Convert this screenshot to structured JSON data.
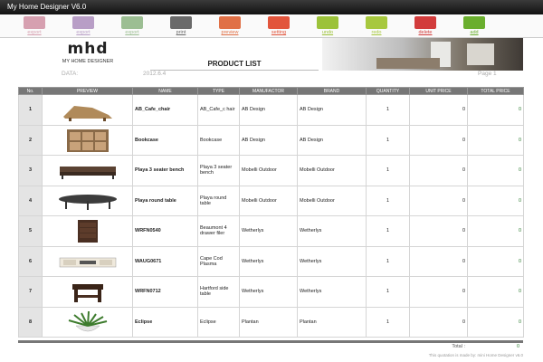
{
  "window": {
    "title": "My Home Designer V6.0"
  },
  "toolbar": [
    {
      "label": "export",
      "color": "#d6a0b0"
    },
    {
      "label": "export",
      "color": "#b89ec6"
    },
    {
      "label": "export",
      "color": "#9cbe93"
    },
    {
      "label": "print",
      "color": "#6a6a6a"
    },
    {
      "label": "preview",
      "color": "#e07046"
    },
    {
      "label": "setting",
      "color": "#e2553c"
    },
    {
      "label": "undo",
      "color": "#9cc23a"
    },
    {
      "label": "redo",
      "color": "#a7c83e"
    },
    {
      "label": "delete",
      "color": "#d23c3c"
    },
    {
      "label": "add",
      "color": "#6aae2e"
    }
  ],
  "header": {
    "logo_mark": "mhd",
    "logo_text": "MY HOME DESIGNER",
    "title": "PRODUCT LIST",
    "date_label": "DATA:",
    "date_value": "2012.6.4",
    "page_label": "Page 1"
  },
  "table": {
    "columns": [
      "No.",
      "PREVIEW",
      "NAME",
      "TYPE",
      "MANUFACTOR",
      "BRAND",
      "QUANTITY",
      "UNIT PRICE",
      "TOTAL PRICE"
    ],
    "rows": [
      {
        "no": "1",
        "preview": "lounge-chair",
        "name": "AB_Cafe_chair",
        "type": "AB_Cafe_c hair",
        "manufactor": "AB Design",
        "brand": "AB Design",
        "quantity": "1",
        "unit_price": "0",
        "total_price": "0"
      },
      {
        "no": "2",
        "preview": "bookcase",
        "name": "Bookcase",
        "type": "Bookcase",
        "manufactor": "AB Design",
        "brand": "AB Design",
        "quantity": "1",
        "unit_price": "0",
        "total_price": "0"
      },
      {
        "no": "3",
        "preview": "sofa",
        "name": "Playa 3 seater bench",
        "type": "Playa 3 seater bench",
        "manufactor": "Mobelli Outdoor",
        "brand": "Mobelli Outdoor",
        "quantity": "1",
        "unit_price": "0",
        "total_price": "0"
      },
      {
        "no": "4",
        "preview": "round-table",
        "name": "Playa round table",
        "type": "Playa round table",
        "manufactor": "Mobelli Outdoor",
        "brand": "Mobelli Outdoor",
        "quantity": "1",
        "unit_price": "0",
        "total_price": "0"
      },
      {
        "no": "5",
        "preview": "drawer",
        "name": "WRFN0540",
        "type": "Beaumont 4 drawer filer",
        "manufactor": "Wetherlys",
        "brand": "Wetherlys",
        "quantity": "1",
        "unit_price": "0",
        "total_price": "0"
      },
      {
        "no": "6",
        "preview": "tv-cabinet",
        "name": "WAUG0671",
        "type": "Cape Cod Plasma",
        "manufactor": "Wetherlys",
        "brand": "Wetherlys",
        "quantity": "1",
        "unit_price": "0",
        "total_price": "0"
      },
      {
        "no": "7",
        "preview": "side-table",
        "name": "WRFN0712",
        "type": "Hartford side table",
        "manufactor": "Wetherlys",
        "brand": "Wetherlys",
        "quantity": "1",
        "unit_price": "0",
        "total_price": "0"
      },
      {
        "no": "8",
        "preview": "plant",
        "name": "Eclipse",
        "type": "Eclipse",
        "manufactor": "Plantan",
        "brand": "Plantan",
        "quantity": "1",
        "unit_price": "0",
        "total_price": "0"
      }
    ]
  },
  "footer": {
    "total_label": "Total :",
    "total_value": "0",
    "note": "This quotation is made by: mini Home Designer v6.0"
  }
}
